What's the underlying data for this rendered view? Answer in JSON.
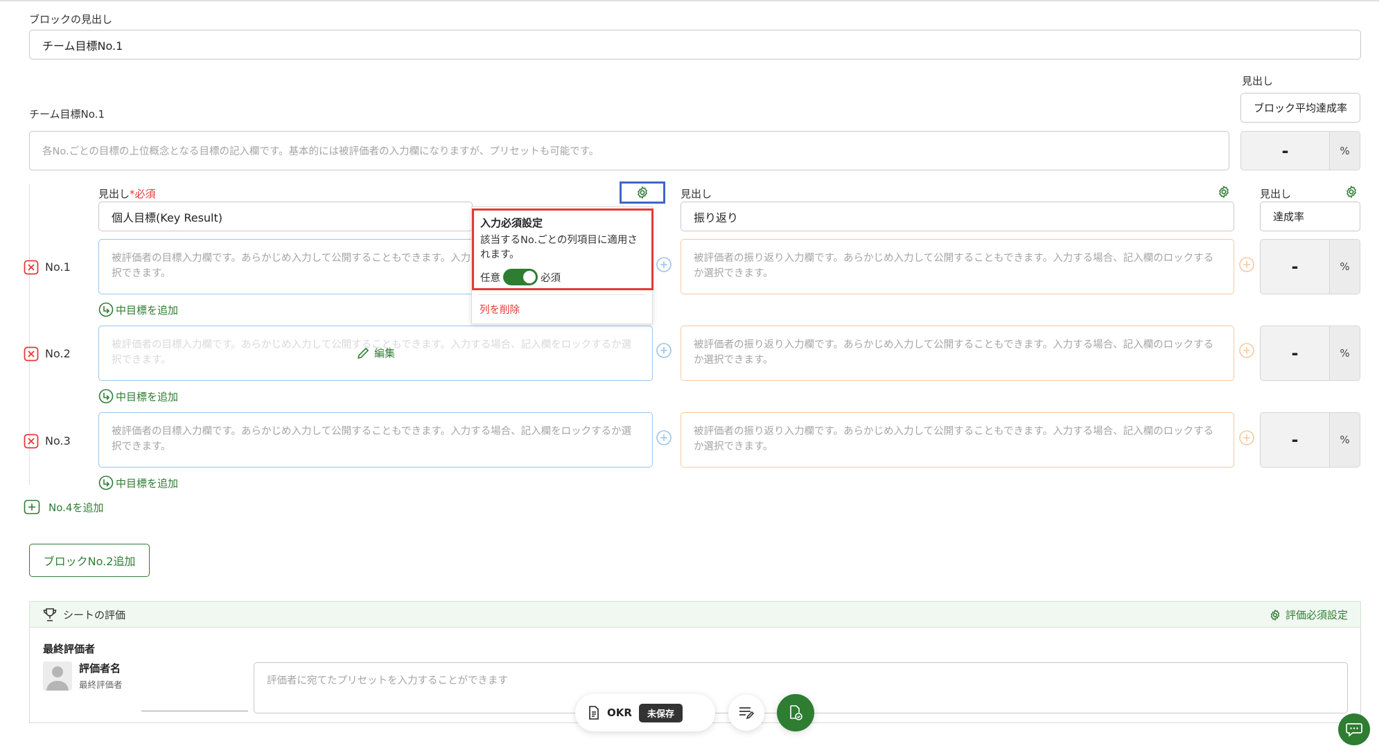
{
  "block": {
    "heading_label": "ブロックの見出し",
    "heading_value": "チーム目標No.1",
    "team_goal_label": "チーム目標No.1",
    "team_goal_placeholder": "各No.ごとの目標の上位概念となる目標の記入欄です。基本的には被評価者の入力欄になりますが、プリセットも可能です。",
    "avg_heading_label": "見出し",
    "avg_heading_value": "ブロック平均達成率",
    "avg_value": "-",
    "percent": "%"
  },
  "columns": [
    {
      "label": "見出し",
      "required_mark": "*必須",
      "value": "個人目標(Key Result)"
    },
    {
      "label": "見出し",
      "value": "振り返り"
    },
    {
      "label": "見出し",
      "value": "達成率"
    }
  ],
  "rows": [
    {
      "label": "No.1",
      "goal_placeholder": "被評価者の目標入力欄です。あらかじめ入力して公開することもできます。入力する場合、記入欄をロックするか選択できます。",
      "review_placeholder": "被評価者の振り返り入力欄です。あらかじめ入力して公開することもできます。入力する場合、記入欄のロックするか選択できます。",
      "rate": "-",
      "add_mid": "中目標を追加"
    },
    {
      "label": "No.2",
      "goal_placeholder": "被評価者の目標入力欄です。あらかじめ入力して公開することもできます。入力する場合、記入欄をロックするか選択できます。",
      "review_placeholder": "被評価者の振り返り入力欄です。あらかじめ入力して公開することもできます。入力する場合、記入欄のロックするか選択できます。",
      "rate": "-",
      "add_mid": "中目標を追加",
      "edit_label": "編集"
    },
    {
      "label": "No.3",
      "goal_placeholder": "被評価者の目標入力欄です。あらかじめ入力して公開することもできます。入力する場合、記入欄をロックするか選択できます。",
      "review_placeholder": "被評価者の振り返り入力欄です。あらかじめ入力して公開することもできます。入力する場合、記入欄のロックするか選択できます。",
      "rate": "-",
      "add_mid": "中目標を追加"
    }
  ],
  "add_row_label": "No.4を追加",
  "add_block_label": "ブロックNo.2追加",
  "popup": {
    "title": "入力必須設定",
    "description": "該当するNo.ごとの列項目に適用されます。",
    "optional_label": "任意",
    "required_label": "必須",
    "toggle_state": "required",
    "delete_label": "列を削除"
  },
  "sheet_eval": {
    "title": "シートの評価",
    "settings_label": "評価必須設定",
    "final_evaluator_label": "最終評価者",
    "evaluator_name": "評価者名",
    "evaluator_role": "最終評価者",
    "comment_placeholder": "評価者に宛てたプリセットを入力することができます"
  },
  "bottom_bar": {
    "doc_name": "OKR",
    "status": "未保存"
  },
  "colors": {
    "accent_green": "#2e7d32",
    "required_red": "#e53935",
    "highlight_red_border": "#e53935",
    "highlight_blue_border": "#3f66c8"
  }
}
